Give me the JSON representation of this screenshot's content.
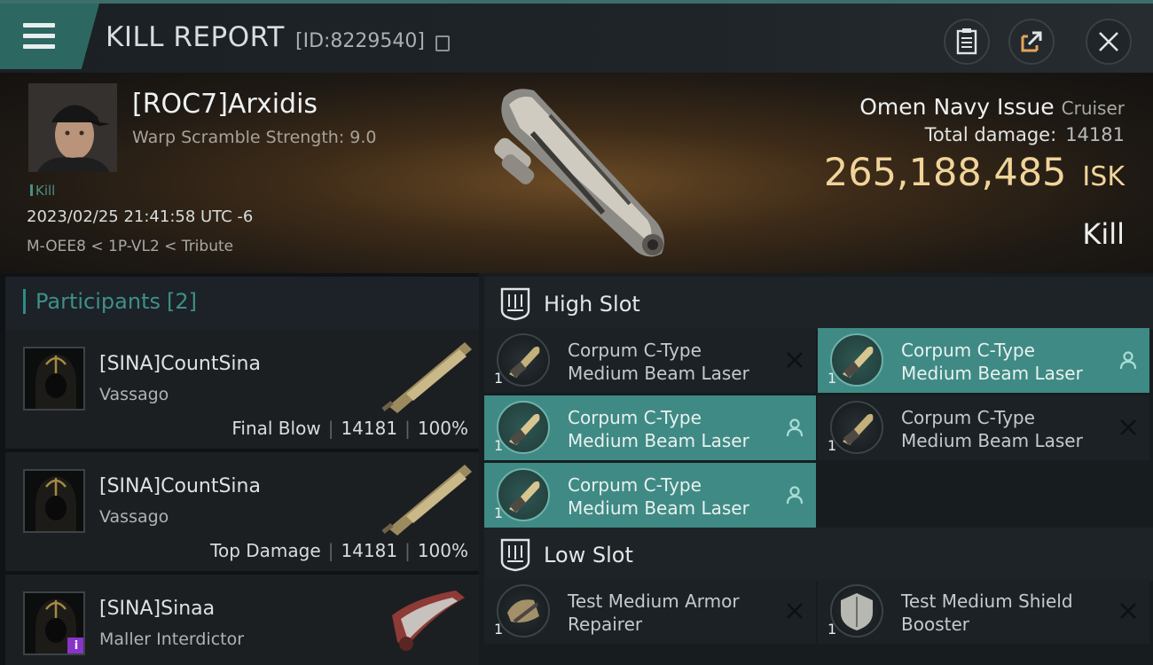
{
  "header": {
    "title": "KILL REPORT",
    "report_id": "[ID:8229540]"
  },
  "victim": {
    "pilot": "[ROC7]Arxidis",
    "warp_scramble": "Warp Scramble Strength: 9.0",
    "tag": "Kill",
    "datetime": "2023/02/25 21:41:58 UTC -6",
    "location": "M-OEE8 < 1P-VL2 < Tribute",
    "ship": "Omen Navy Issue",
    "ship_class": "Cruiser",
    "damage_label": "Total damage:",
    "damage_value": "14181",
    "isk_value": "265,188,485",
    "isk_unit": "ISK",
    "result": "Kill"
  },
  "participants": {
    "label": "Participants",
    "count": "[2]",
    "rows": [
      {
        "name": "[SINA]CountSina",
        "ship": "Vassago",
        "role": "Final Blow",
        "damage": "14181",
        "percent": "100%"
      },
      {
        "name": "[SINA]CountSina",
        "ship": "Vassago",
        "role": "Top Damage",
        "damage": "14181",
        "percent": "100%"
      },
      {
        "name": "[SINA]Sinaa",
        "ship": "Maller Interdictor",
        "badge": "i"
      }
    ]
  },
  "fitting": {
    "high_slot_label": "High Slot",
    "low_slot_label": "Low Slot",
    "high": [
      {
        "name": "Corpum C-Type Medium Beam Laser",
        "qty": "1",
        "status": "destroyed"
      },
      {
        "name": "Corpum C-Type Medium Beam Laser",
        "qty": "1",
        "status": "dropped"
      },
      {
        "name": "Corpum C-Type Medium Beam Laser",
        "qty": "1",
        "status": "dropped"
      },
      {
        "name": "Corpum C-Type Medium Beam Laser",
        "qty": "1",
        "status": "destroyed"
      },
      {
        "name": "Corpum C-Type Medium Beam Laser",
        "qty": "1",
        "status": "dropped"
      }
    ],
    "low": [
      {
        "name": "Test Medium Armor Repairer",
        "qty": "1",
        "status": "destroyed"
      },
      {
        "name": "Test Medium Shield Booster",
        "qty": "1",
        "status": "destroyed"
      }
    ]
  },
  "colors": {
    "accent_teal": "#3f8a84",
    "isk_gold": "#f0d49a"
  }
}
